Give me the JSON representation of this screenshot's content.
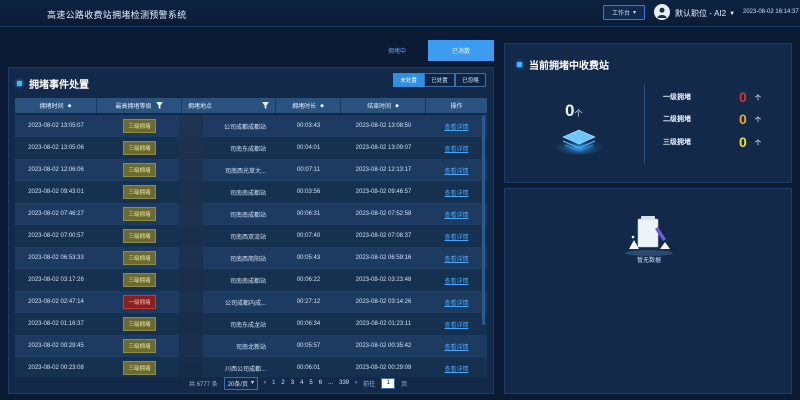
{
  "header": {
    "title": "高速公路收费站拥堵检测预警系统",
    "workbench_label": "工作台",
    "user_name": "默认职位 - AI2",
    "datetime": "2023-08-02 16:14:37"
  },
  "top_tabs": [
    {
      "label": "拥堵中",
      "active": false
    },
    {
      "label": "已消散",
      "active": true
    }
  ],
  "events_panel": {
    "title": "拥堵事件处置",
    "filters": [
      {
        "label": "未处置",
        "active": true
      },
      {
        "label": "已处置",
        "active": false
      },
      {
        "label": "已忽略",
        "active": false
      }
    ],
    "columns": [
      "拥堵时间",
      "最高拥堵等级",
      "拥堵地点",
      "拥堵时长",
      "结束时间",
      "操作"
    ],
    "rows": [
      {
        "time": "2023-08-02 13:05:07",
        "level": "三级拥堵",
        "level_type": "yellow",
        "location": "公司成都成都站",
        "duration": "00:03:43",
        "end": "2023-08-02 13:08:50",
        "action": "查看详情"
      },
      {
        "time": "2023-08-02 13:05:06",
        "level": "三级拥堵",
        "level_type": "yellow",
        "location": "司南东成都站",
        "duration": "00:04:01",
        "end": "2023-08-02 13:09:07",
        "action": "查看详情"
      },
      {
        "time": "2023-08-02 12:06:06",
        "level": "三级拥堵",
        "level_type": "yellow",
        "location": "司南西光草大...",
        "duration": "00:07:11",
        "end": "2023-08-02 12:13:17",
        "action": "查看详情"
      },
      {
        "time": "2023-08-02 09:43:01",
        "level": "三级拥堵",
        "level_type": "yellow",
        "location": "司南南成都站",
        "duration": "00:03:56",
        "end": "2023-08-02 09:46:57",
        "action": "查看详情"
      },
      {
        "time": "2023-08-02 07:46:27",
        "level": "三级拥堵",
        "level_type": "yellow",
        "location": "司南南成都站",
        "duration": "00:06:31",
        "end": "2023-08-02 07:52:58",
        "action": "查看详情"
      },
      {
        "time": "2023-08-02 07:00:57",
        "level": "三级拥堵",
        "level_type": "yellow",
        "location": "司南西双流站",
        "duration": "00:07:40",
        "end": "2023-08-02 07:08:37",
        "action": "查看详情"
      },
      {
        "time": "2023-08-02 06:53:33",
        "level": "三级拥堵",
        "level_type": "yellow",
        "location": "司南西简阳站",
        "duration": "00:05:43",
        "end": "2023-08-02 06:59:16",
        "action": "查看详情"
      },
      {
        "time": "2023-08-02 03:17:26",
        "level": "三级拥堵",
        "level_type": "yellow",
        "location": "司南南成都站",
        "duration": "00:06:22",
        "end": "2023-08-02 03:23:48",
        "action": "查看详情"
      },
      {
        "time": "2023-08-02 02:47:14",
        "level": "一级拥堵",
        "level_type": "red",
        "location": "公司成都内成...",
        "duration": "00:27:12",
        "end": "2023-08-02 03:14:26",
        "action": "查看详情"
      },
      {
        "time": "2023-08-02 01:16:37",
        "level": "三级拥堵",
        "level_type": "yellow",
        "location": "司南东成龙站",
        "duration": "00:06:34",
        "end": "2023-08-02 01:23:11",
        "action": "查看详情"
      },
      {
        "time": "2023-08-02 00:29:45",
        "level": "三级拥堵",
        "level_type": "yellow",
        "location": "司南北新站",
        "duration": "00:05:57",
        "end": "2023-08-02 00:35:42",
        "action": "查看详情"
      },
      {
        "time": "2023-08-02 00:23:08",
        "level": "三级拥堵",
        "level_type": "yellow",
        "location": "川西公司成都...",
        "duration": "00:06:01",
        "end": "2023-08-02 00:29:09",
        "action": "查看详情"
      }
    ],
    "pagination": {
      "total": "共 6777 条",
      "page_size": "20条/页",
      "pages": [
        "1",
        "2",
        "3",
        "4",
        "5",
        "6",
        "...",
        "339"
      ],
      "active_page": "1",
      "prev": "‹",
      "next": "›",
      "goto_label": "前往",
      "goto_value": "1",
      "goto_suffix": "页"
    }
  },
  "current_panel": {
    "title": "当前拥堵中收费站",
    "total_count": "0",
    "total_unit": "个",
    "levels": [
      {
        "label": "一级拥堵",
        "count": "0",
        "unit": "个",
        "color": "#e0302f"
      },
      {
        "label": "二级拥堵",
        "count": "0",
        "unit": "个",
        "color": "#f5a623"
      },
      {
        "label": "三级拥堵",
        "count": "0",
        "unit": "个",
        "color": "#f2e12b"
      }
    ]
  },
  "empty_panel": {
    "text": "暂无数据"
  },
  "colors": {
    "accent": "#3d9bf0",
    "background": "#0b1b33",
    "panel": "#13294a"
  }
}
